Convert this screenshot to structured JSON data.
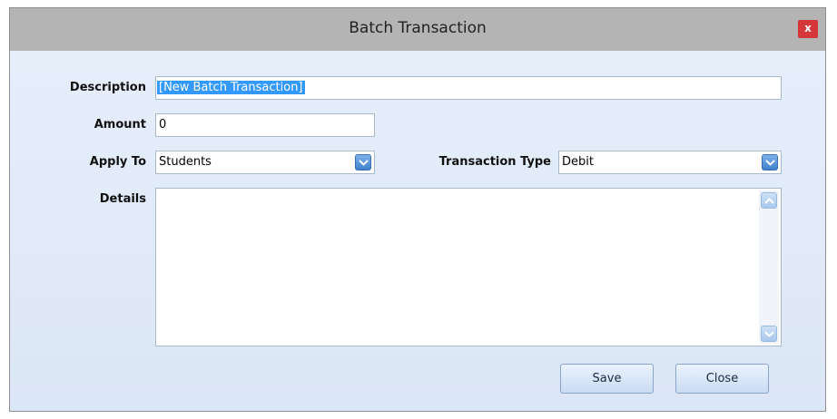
{
  "window": {
    "title": "Batch Transaction",
    "close_label": "x"
  },
  "form": {
    "description_label": "Description",
    "description_value": "[New Batch Transaction]",
    "amount_label": "Amount",
    "amount_value": "0",
    "apply_to_label": "Apply To",
    "apply_to_value": "Students",
    "transaction_type_label": "Transaction Type",
    "transaction_type_value": "Debit",
    "details_label": "Details",
    "details_value": ""
  },
  "buttons": {
    "save_label": "Save",
    "close_label": "Close"
  },
  "colors": {
    "titlebar": "#b4b4b4",
    "close_button": "#d6373a",
    "dialog_background": "#dfe9f7",
    "selection_highlight": "#3399ff",
    "dropdown_button": "#3f80cf"
  },
  "icons": {
    "dropdown": "chevron-down-icon",
    "scroll_up": "chevron-up-icon",
    "scroll_down": "chevron-down-icon",
    "close": "close-icon"
  }
}
